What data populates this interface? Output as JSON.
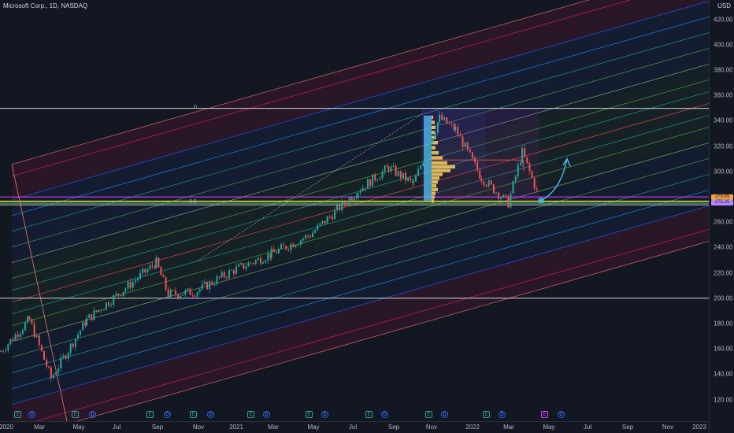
{
  "header": {
    "title": "Microsoft Corp., 1D, NASDAQ",
    "currency": "USD"
  },
  "colors": {
    "background": "#131722",
    "up": "#26a69a",
    "down": "#ef5350",
    "profile": "#f0c75e",
    "profile_base": "#4fc3f7",
    "sr_line": "#ffffff",
    "pivot_line": "#cddc39"
  },
  "chart_data": {
    "type": "candlestick",
    "title": "Microsoft Corp., 1D, NASDAQ",
    "ylabel": "USD",
    "ylim": [
      110,
      425
    ],
    "y_ticks": [
      "420.00",
      "400.00",
      "380.00",
      "360.00",
      "340.00",
      "320.00",
      "300.00",
      "280.00",
      "260.00",
      "240.00",
      "220.00",
      "200.00",
      "180.00",
      "160.00",
      "140.00",
      "120.00"
    ],
    "x_ticks": [
      "2020",
      "Mar",
      "May",
      "Jul",
      "Sep",
      "Nov",
      "2021",
      "Mar",
      "May",
      "Jul",
      "Sep",
      "Nov",
      "2022",
      "Mar",
      "May",
      "Jul",
      "Sep",
      "Nov",
      "2023"
    ],
    "price_path_approx": [
      {
        "date": "2020-01-01",
        "price": 158
      },
      {
        "date": "2020-02-15",
        "price": 183
      },
      {
        "date": "2020-03-20",
        "price": 137
      },
      {
        "date": "2020-05-15",
        "price": 183
      },
      {
        "date": "2020-07-15",
        "price": 208
      },
      {
        "date": "2020-09-01",
        "price": 228
      },
      {
        "date": "2020-09-20",
        "price": 203
      },
      {
        "date": "2020-11-01",
        "price": 205
      },
      {
        "date": "2021-01-01",
        "price": 222
      },
      {
        "date": "2021-03-01",
        "price": 235
      },
      {
        "date": "2021-05-01",
        "price": 250
      },
      {
        "date": "2021-07-15",
        "price": 285
      },
      {
        "date": "2021-09-01",
        "price": 303
      },
      {
        "date": "2021-10-10",
        "price": 290
      },
      {
        "date": "2021-11-20",
        "price": 342
      },
      {
        "date": "2021-12-15",
        "price": 333
      },
      {
        "date": "2022-01-25",
        "price": 295
      },
      {
        "date": "2022-03-08",
        "price": 275
      },
      {
        "date": "2022-03-30",
        "price": 315
      },
      {
        "date": "2022-04-25",
        "price": 280
      }
    ],
    "horizontal_levels": [
      {
        "label": "0",
        "price": 349.7
      },
      {
        "label": "0.5",
        "price": 275.5
      },
      {
        "price": 200.0
      }
    ],
    "price_tags": [
      "279.85",
      "275.25"
    ],
    "events": [
      "E",
      "D",
      "E",
      "D",
      "E",
      "D",
      "E",
      "D",
      "E",
      "D",
      "E",
      "D",
      "E",
      "D",
      "E",
      "D",
      "E",
      "D",
      "E"
    ],
    "projection": "curved arrow up from about 277 toward 310"
  }
}
